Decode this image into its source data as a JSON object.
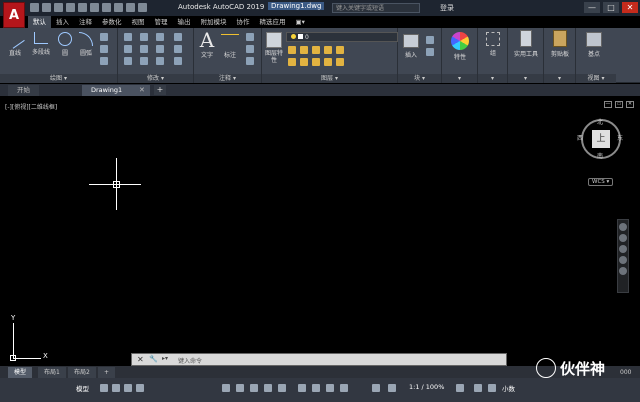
{
  "titlebar": {
    "app_button_letter": "A",
    "app_title": "Autodesk AutoCAD 2019",
    "file_title": "Drawing1.dwg",
    "search_placeholder": "键入关键字或短语",
    "signin_label": "登录",
    "minimize": "—",
    "maximize": "□",
    "close": "✕"
  },
  "ribbon_tabs": [
    "默认",
    "插入",
    "注释",
    "参数化",
    "视图",
    "管理",
    "输出",
    "附加模块",
    "协作",
    "精选应用",
    "▣▾"
  ],
  "ribbon": {
    "draw": {
      "panel_label": "绘图 ▾",
      "line": "直线",
      "polyline": "多段线",
      "circle": "圆",
      "arc": "圆弧"
    },
    "modify": {
      "panel_label": "修改 ▾"
    },
    "annotation": {
      "panel_label": "注释 ▾",
      "text": "文字",
      "dimension": "标注",
      "text_icon": "A"
    },
    "layers": {
      "panel_label": "图层 ▾",
      "layer_properties": "图层特性",
      "current_layer": "0"
    },
    "block": {
      "panel_label": "块 ▾",
      "insert": "插入"
    },
    "properties": {
      "label": "特性"
    },
    "groups": {
      "label": "组"
    },
    "utilities": {
      "label": "实用工具"
    },
    "clipboard": {
      "label": "剪贴板"
    },
    "view": {
      "label": "基点",
      "panel_label": "视图 ▾"
    }
  },
  "file_tabs": {
    "start": "开始",
    "drawing": "Drawing1",
    "close": "✕",
    "add": "+"
  },
  "canvas": {
    "view_label": "[-][俯视][二维线框]",
    "viewcube": {
      "face": "上",
      "north": "北",
      "south": "南",
      "east": "东",
      "west": "西",
      "wcs": "WCS ▾"
    },
    "ucs_x": "X",
    "ucs_y": "Y",
    "minimize": "—",
    "restore": "▭",
    "close": "✕"
  },
  "command_line": {
    "close": "✕",
    "wrench": "🔧",
    "dropdown": "▸▾",
    "placeholder": "键入命令"
  },
  "layout_tabs": [
    "模型",
    "布局1",
    "布局2",
    "+"
  ],
  "statusbar": {
    "model": "模型",
    "scale": "1:1 / 100%",
    "units": "小数"
  },
  "watermark": {
    "text": "伙伴神",
    "tail": "000"
  }
}
